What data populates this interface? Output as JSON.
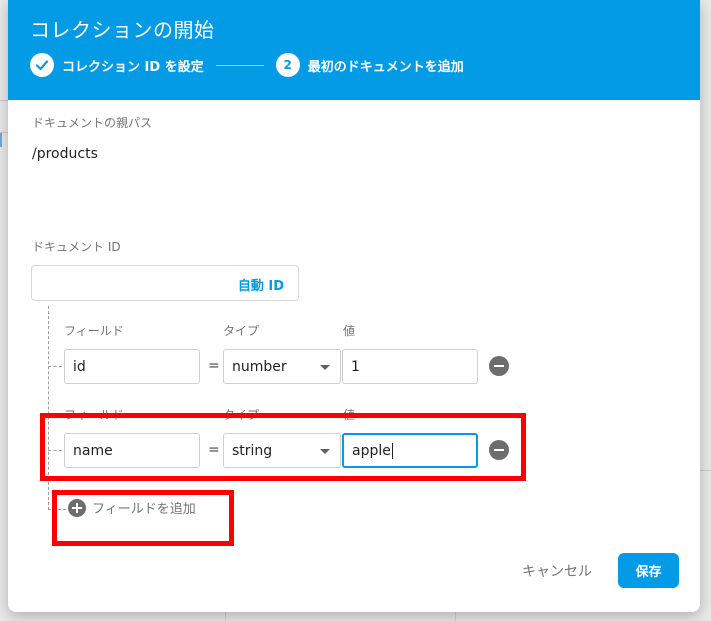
{
  "dialog": {
    "title": "コレクションの開始",
    "steps": [
      {
        "number": "✓",
        "label": "コレクション ID を設定",
        "state": "done"
      },
      {
        "number": "2",
        "label": "最初のドキュメントを追加",
        "state": "active"
      }
    ]
  },
  "parent_path": {
    "label": "ドキュメントの親パス",
    "value": "/products"
  },
  "document_id": {
    "label": "ドキュメント ID",
    "value": "",
    "auto_id_label": "自動 ID"
  },
  "fields": [
    {
      "field_label": "フィールド",
      "type_label": "タイプ",
      "value_label": "値",
      "name": "id",
      "type": "number",
      "value": "1"
    },
    {
      "field_label": "フィールド",
      "type_label": "タイプ",
      "value_label": "値",
      "name": "name",
      "type": "string",
      "value": "apple"
    }
  ],
  "equals_sign": "=",
  "add_field_label": "フィールドを追加",
  "actions": {
    "cancel_label": "キャンセル",
    "save_label": "保存"
  },
  "colors": {
    "accent": "#039be5",
    "highlight": "#ff0000"
  }
}
